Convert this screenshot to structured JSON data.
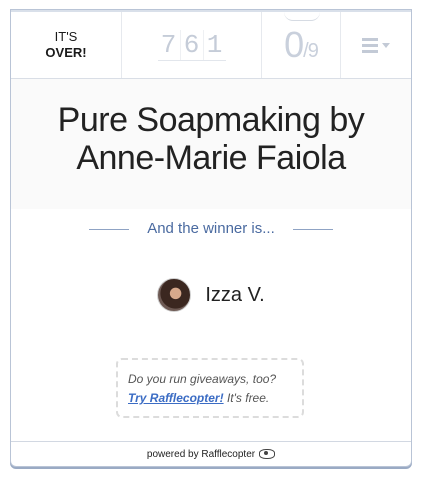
{
  "status": {
    "line1": "IT'S",
    "line2": "OVER!"
  },
  "entries": {
    "digits": [
      "7",
      "6",
      "1"
    ]
  },
  "my_entries": {
    "count": "0",
    "total": "/9"
  },
  "menu": {
    "icon": "hamburger-menu-icon"
  },
  "giveaway": {
    "title": "Pure Soapmaking by Anne-Marie Faiola"
  },
  "winner_section": {
    "label": "And the winner is..."
  },
  "winner": {
    "name": "Izza V."
  },
  "promo": {
    "question": "Do you run giveaways, too?",
    "link": "Try Rafflecopter!",
    "suffix": "It's free."
  },
  "footer": {
    "text": "powered by Rafflecopter"
  },
  "colors": {
    "accent": "#3b6cc4",
    "border": "#b9c4d6",
    "label": "#4a6aa0"
  }
}
